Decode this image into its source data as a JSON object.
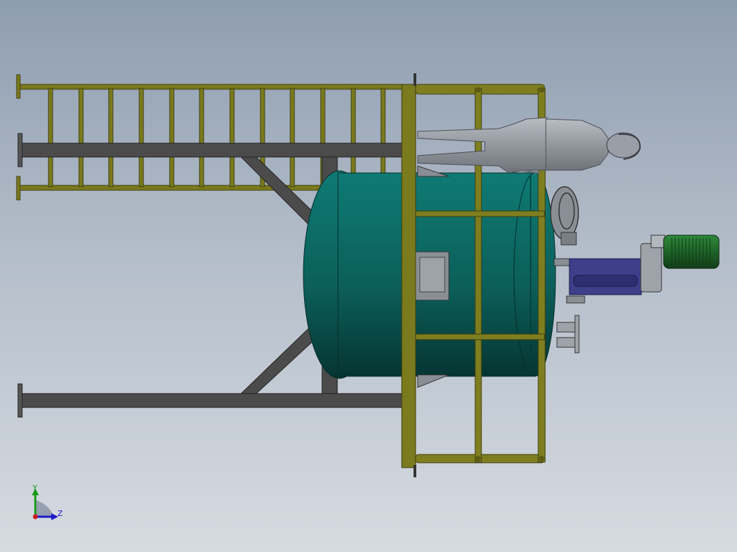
{
  "viewport": {
    "background_top": "#8e9db0",
    "background_bottom": "#d6dbe1"
  },
  "colors": {
    "ladder": "#7a7a1e",
    "ladder_dark": "#4d4d10",
    "frame": "#4b4b4b",
    "frame_edge": "#2a2a2a",
    "tank": "#0f6f6a",
    "tank_dark": "#08403d",
    "motor": "#1f6b2a",
    "shaft": "#3d3f8a",
    "figure": "#9a9ea6",
    "hatch": "#8a8f96"
  },
  "model": {
    "parts": [
      {
        "name": "ladder",
        "kind": "access ladder"
      },
      {
        "name": "support-frame",
        "kind": "steel support legs"
      },
      {
        "name": "platform-railing",
        "kind": "guard rail"
      },
      {
        "name": "tank",
        "kind": "reactor vessel"
      },
      {
        "name": "agitator-motor",
        "kind": "drive motor"
      },
      {
        "name": "human-figure",
        "kind": "scale reference"
      },
      {
        "name": "manhole",
        "kind": "inspection hatch"
      },
      {
        "name": "nozzles",
        "kind": "pipe nozzles"
      }
    ]
  },
  "triad": {
    "y_label": "Y",
    "z_label": "Z",
    "y_color": "#1a9a1a",
    "z_color": "#1a1acc",
    "origin_color": "#cc1a1a"
  }
}
